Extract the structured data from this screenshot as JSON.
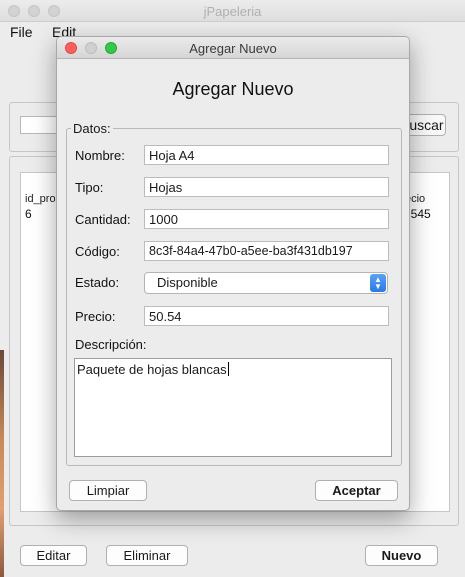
{
  "main_window": {
    "title": "jPapeleria",
    "menu": [
      "File",
      "Edit"
    ],
    "search_button_label": "Buscar",
    "table": {
      "columns": [
        "id_pro",
        "Precio"
      ],
      "rows": [
        [
          "6",
          "50.545"
        ]
      ]
    },
    "buttons": {
      "edit": "Editar",
      "delete": "Eliminar",
      "new": "Nuevo"
    }
  },
  "dialog": {
    "title": "Agregar Nuevo",
    "heading": "Agregar Nuevo",
    "group_label": "Datos:",
    "fields": {
      "nombre": {
        "label": "Nombre:",
        "value": "Hoja A4"
      },
      "tipo": {
        "label": "Tipo:",
        "value": "Hojas"
      },
      "cantidad": {
        "label": "Cantidad:",
        "value": "1000"
      },
      "codigo": {
        "label": "Código:",
        "value": "8c3f-84a4-47b0-a5ee-ba3f431db197"
      },
      "estado": {
        "label": "Estado:",
        "value": "Disponible"
      },
      "precio": {
        "label": "Precio:",
        "value": "50.54"
      },
      "descripcion": {
        "label": "Descripción:",
        "value": "Paquete de hojas blancas"
      }
    },
    "buttons": {
      "clear": "Limpiar",
      "accept": "Aceptar"
    }
  },
  "colors": {
    "close": "#fc605b",
    "minimize": "#d0d0d0",
    "zoom": "#34c84a",
    "select_accent": "#2b79e4"
  }
}
